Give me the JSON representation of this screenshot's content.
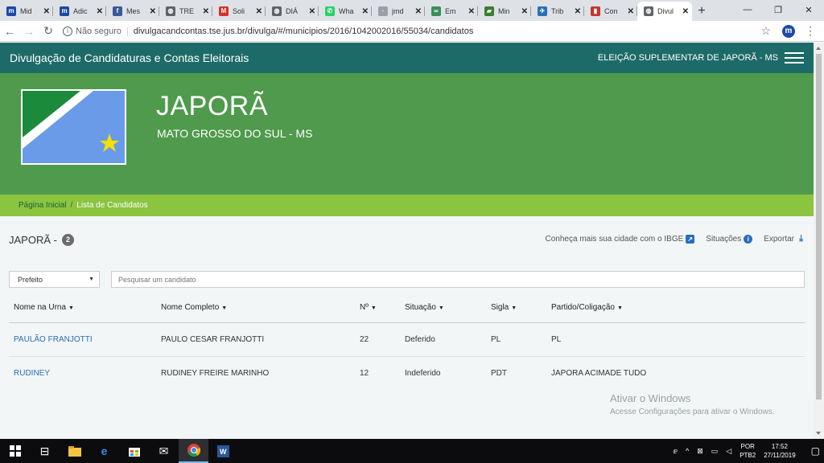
{
  "browser": {
    "tabs": [
      {
        "label": "Mid",
        "icon": "m-icon",
        "color": "#1d4aa8"
      },
      {
        "label": "Adic",
        "icon": "m-icon",
        "color": "#1d4aa8"
      },
      {
        "label": "Mes",
        "icon": "facebook-icon",
        "color": "#3b5998"
      },
      {
        "label": "TRE",
        "icon": "globe-icon",
        "color": "#5f6368"
      },
      {
        "label": "Soli",
        "icon": "gmail-icon",
        "color": "#d93025"
      },
      {
        "label": "DIÁ",
        "icon": "globe-icon",
        "color": "#5f6368"
      },
      {
        "label": "Wha",
        "icon": "whatsapp-icon",
        "color": "#25d366"
      },
      {
        "label": "jmd",
        "icon": "dot-icon",
        "color": "#9aa0a6"
      },
      {
        "label": "Em",
        "icon": "link-icon",
        "color": "#3a8f5c"
      },
      {
        "label": "Min",
        "icon": "flag-icon",
        "color": "#3a7d2a"
      },
      {
        "label": "Trib",
        "icon": "plane-icon",
        "color": "#2a6ebb"
      },
      {
        "label": "Con",
        "icon": "chart-icon",
        "color": "#c0392b"
      }
    ],
    "active_tab": {
      "label": "Divul",
      "icon": "globe-icon"
    },
    "new_tab": "+",
    "window_controls": {
      "minimize": "—",
      "restore": "❐",
      "close": "✕"
    },
    "address": {
      "security_text": "Não seguro",
      "url": "divulgacandcontas.tse.jus.br/divulga/#/municipios/2016/1042002016/55034/candidatos"
    }
  },
  "header": {
    "brand": "Divulgação de Candidaturas e Contas Eleitorais",
    "election": "ELEIÇÃO SUPLEMENTAR DE JAPORÃ - MS"
  },
  "hero": {
    "city": "JAPORÃ",
    "state": "MATO GROSSO DO SUL - MS"
  },
  "breadcrumb": {
    "home": "Página Inicial",
    "separator": "/",
    "current": "Lista de Candidatos"
  },
  "main": {
    "title": "JAPORÃ -",
    "count": "2",
    "actions": {
      "ibge": "Conheça mais sua cidade com o IBGE",
      "situacoes": "Situações",
      "exportar": "Exportar"
    },
    "filter": {
      "selected": "Prefeito"
    },
    "search": {
      "placeholder": "Pesquisar um candidato"
    },
    "table": {
      "headers": [
        "Nome na Urna",
        "Nome Completo",
        "Nº",
        "Situação",
        "Sigla",
        "Partido/Coligação"
      ],
      "rows": [
        [
          "PAULÃO FRANJOTTI",
          "PAULO CESAR FRANJOTTI",
          "22",
          "Deferido",
          "PL",
          "PL"
        ],
        [
          "RUDINEY",
          "RUDINEY FREIRE MARINHO",
          "12",
          "Indeferido",
          "PDT",
          "JAPORA ACIMADE TUDO"
        ]
      ]
    }
  },
  "watermark": {
    "line1": "Ativar o Windows",
    "line2": "Acesse Configurações para ativar o Windows."
  },
  "taskbar": {
    "lang_line1": "POR",
    "lang_line2": "PTB2",
    "time": "17:52",
    "date": "27/11/2019"
  },
  "colors": {
    "header_bg": "#1d6b68",
    "hero_bg": "#4f9a4c",
    "breadcrumb_bg": "#8bc43f",
    "link": "#2a6ebb"
  }
}
